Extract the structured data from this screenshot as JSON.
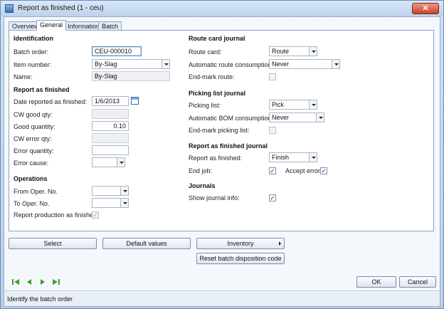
{
  "window": {
    "title": "Report as finished (1 - ceu)",
    "close_label": "✕"
  },
  "tabs": [
    {
      "label": "Overview"
    },
    {
      "label": "General"
    },
    {
      "label": "Information"
    },
    {
      "label": "Batch"
    }
  ],
  "identification": {
    "heading": "Identification",
    "batch_order_label": "Batch order:",
    "batch_order_value": "CEU-000010",
    "item_number_label": "Item number:",
    "item_number_value": "By-Slag",
    "name_label": "Name:",
    "name_value": "By-Slag"
  },
  "report_as_finished": {
    "heading": "Report as finished",
    "date_label": "Date reported as finished:",
    "date_value": "1/6/2013",
    "cw_good_label": "CW good qty:",
    "cw_good_value": "",
    "good_qty_label": "Good quantity:",
    "good_qty_value": "0.10",
    "cw_error_label": "CW error qty:",
    "cw_error_value": "",
    "error_qty_label": "Error quantity:",
    "error_qty_value": "",
    "error_cause_label": "Error cause:",
    "error_cause_value": ""
  },
  "operations": {
    "heading": "Operations",
    "from_label": "From Oper. No.",
    "from_value": "",
    "to_label": "To Oper. No.",
    "to_value": "",
    "report_prod_label": "Report production as finished:",
    "report_prod_checked": true
  },
  "route_card": {
    "heading": "Route card journal",
    "route_card_label": "Route card:",
    "route_card_value": "Route",
    "auto_consumption_label": "Automatic route consumption:",
    "auto_consumption_value": "Never",
    "end_mark_label": "End-mark route:",
    "end_mark_checked": false
  },
  "picking_list": {
    "heading": "Picking list journal",
    "picking_list_label": "Picking list:",
    "picking_list_value": "Pick",
    "auto_bom_label": "Automatic BOM consumption:",
    "auto_bom_value": "Never",
    "end_mark_label": "End-mark picking list:",
    "end_mark_checked": false
  },
  "raf_journal": {
    "heading": "Report as finished journal",
    "raf_label": "Report as finished:",
    "raf_value": "Finish",
    "end_job_label": "End job:",
    "end_job_checked": true,
    "accept_error_label": "Accept error:",
    "accept_error_checked": true
  },
  "journals": {
    "heading": "Journals",
    "show_info_label": "Show journal info:",
    "show_info_checked": true
  },
  "actions": {
    "select": "Select",
    "default_values": "Default values",
    "inventory": "Inventory",
    "reset_batch": "Reset batch disposition code",
    "ok": "OK",
    "cancel": "Cancel"
  },
  "status_bar": {
    "text": "Identify the batch order"
  },
  "checkmark": "✓",
  "colors": {
    "accent": "#3b6fb0",
    "nav_green": "#3aa12b"
  }
}
